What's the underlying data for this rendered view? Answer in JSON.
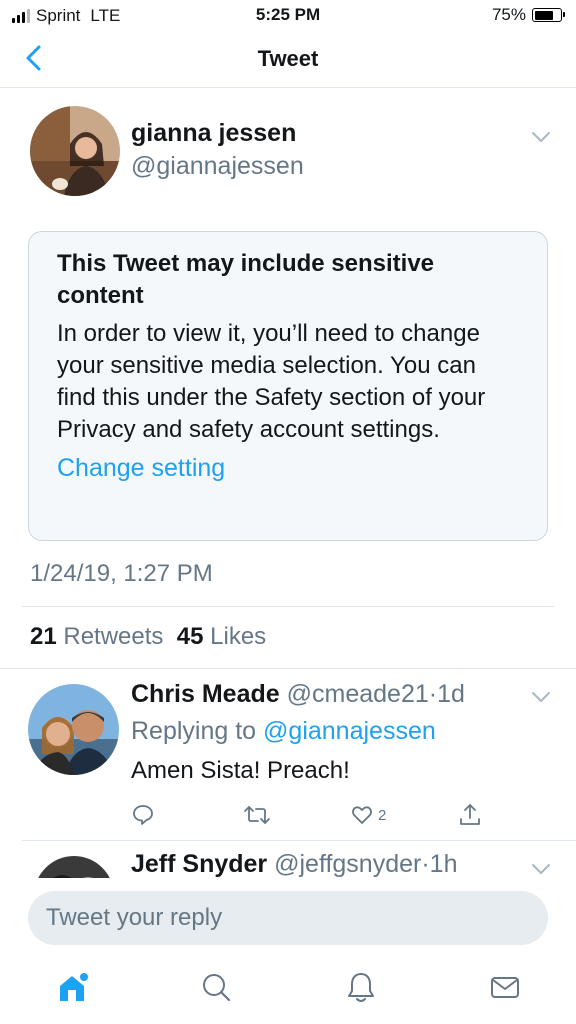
{
  "status_bar": {
    "carrier": "Sprint",
    "network": "LTE",
    "time": "5:25 PM",
    "battery": "75%",
    "battery_level": 0.75
  },
  "nav": {
    "title": "Tweet"
  },
  "tweet": {
    "author_name": "gianna jessen",
    "author_handle": "@giannajessen",
    "sensitive": {
      "title": "This Tweet may include sensitive content",
      "body": "In order to view it, you’ll need to change your sensitive media selection. You can find this under the Safety section of your Privacy and safety account settings.",
      "link": "Change setting"
    },
    "timestamp": "1/24/19, 1:27 PM",
    "retweet_count": "21",
    "retweet_label": "Retweets",
    "like_count": "45",
    "like_label": "Likes"
  },
  "replies": [
    {
      "name": "Chris Meade",
      "handle": "@cmeade21",
      "time": "1d",
      "replying_label": "Replying to",
      "replying_to": "@giannajessen",
      "text": "Amen Sista! Preach!",
      "like_count": "2"
    },
    {
      "name": "Jeff Snyder",
      "handle": "@jeffgsnyder",
      "time": "1h"
    }
  ],
  "composer": {
    "placeholder": "Tweet your reply"
  },
  "icons": {
    "back": "chevron-left-icon",
    "caret": "chevron-down-icon",
    "reply": "comment-icon",
    "retweet": "retweet-icon",
    "like": "heart-icon",
    "share": "share-icon",
    "tabs": [
      "home-icon",
      "search-icon",
      "bell-icon",
      "mail-icon"
    ]
  },
  "colors": {
    "accent": "#1da1f2",
    "secondary_text": "#657786",
    "divider": "#e1e8ed",
    "box_bg": "#f5f8fa"
  }
}
